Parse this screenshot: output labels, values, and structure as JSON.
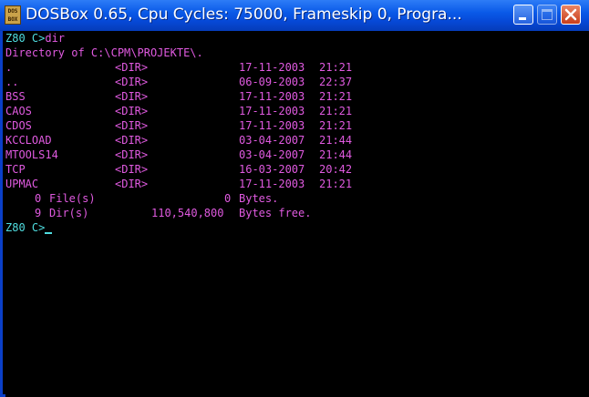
{
  "window": {
    "title": "DOSBox 0.65, Cpu Cycles:     75000, Frameskip  0, Progra...",
    "icon_text": [
      "DOS",
      "BOX"
    ],
    "buttons": [
      "minimize-icon",
      "maximize-icon",
      "close-icon"
    ],
    "colors": {
      "titlebar": "#0a5ae8",
      "text": "#e05ae0",
      "prompt": "#4fdde0",
      "background": "#000000"
    }
  },
  "console": {
    "command_prompt": "Z80 C>",
    "command": "dir",
    "directory_header": "Directory of C:\\CPM\\PROJEKTE\\.",
    "entries": [
      {
        "name": ".",
        "type": "<DIR>",
        "date": "17-11-2003",
        "time": "21:21"
      },
      {
        "name": "..",
        "type": "<DIR>",
        "date": "06-09-2003",
        "time": "22:37"
      },
      {
        "name": "BSS",
        "type": "<DIR>",
        "date": "17-11-2003",
        "time": "21:21"
      },
      {
        "name": "CAOS",
        "type": "<DIR>",
        "date": "17-11-2003",
        "time": "21:21"
      },
      {
        "name": "CDOS",
        "type": "<DIR>",
        "date": "17-11-2003",
        "time": "21:21"
      },
      {
        "name": "KCCLOAD",
        "type": "<DIR>",
        "date": "03-04-2007",
        "time": "21:44"
      },
      {
        "name": "MTOOLS14",
        "type": "<DIR>",
        "date": "03-04-2007",
        "time": "21:44"
      },
      {
        "name": "TCP",
        "type": "<DIR>",
        "date": "16-03-2007",
        "time": "20:42"
      },
      {
        "name": "UPMAC",
        "type": "<DIR>",
        "date": "17-11-2003",
        "time": "21:21"
      }
    ],
    "files_count": "0",
    "files_label": "File(s)",
    "files_bytes": "0",
    "files_bytes_label": "Bytes.",
    "dirs_count": "9",
    "dirs_label": "Dir(s)",
    "dirs_bytes": "110,540,800",
    "dirs_bytes_label": "Bytes free.",
    "final_prompt": "Z80 C>"
  }
}
